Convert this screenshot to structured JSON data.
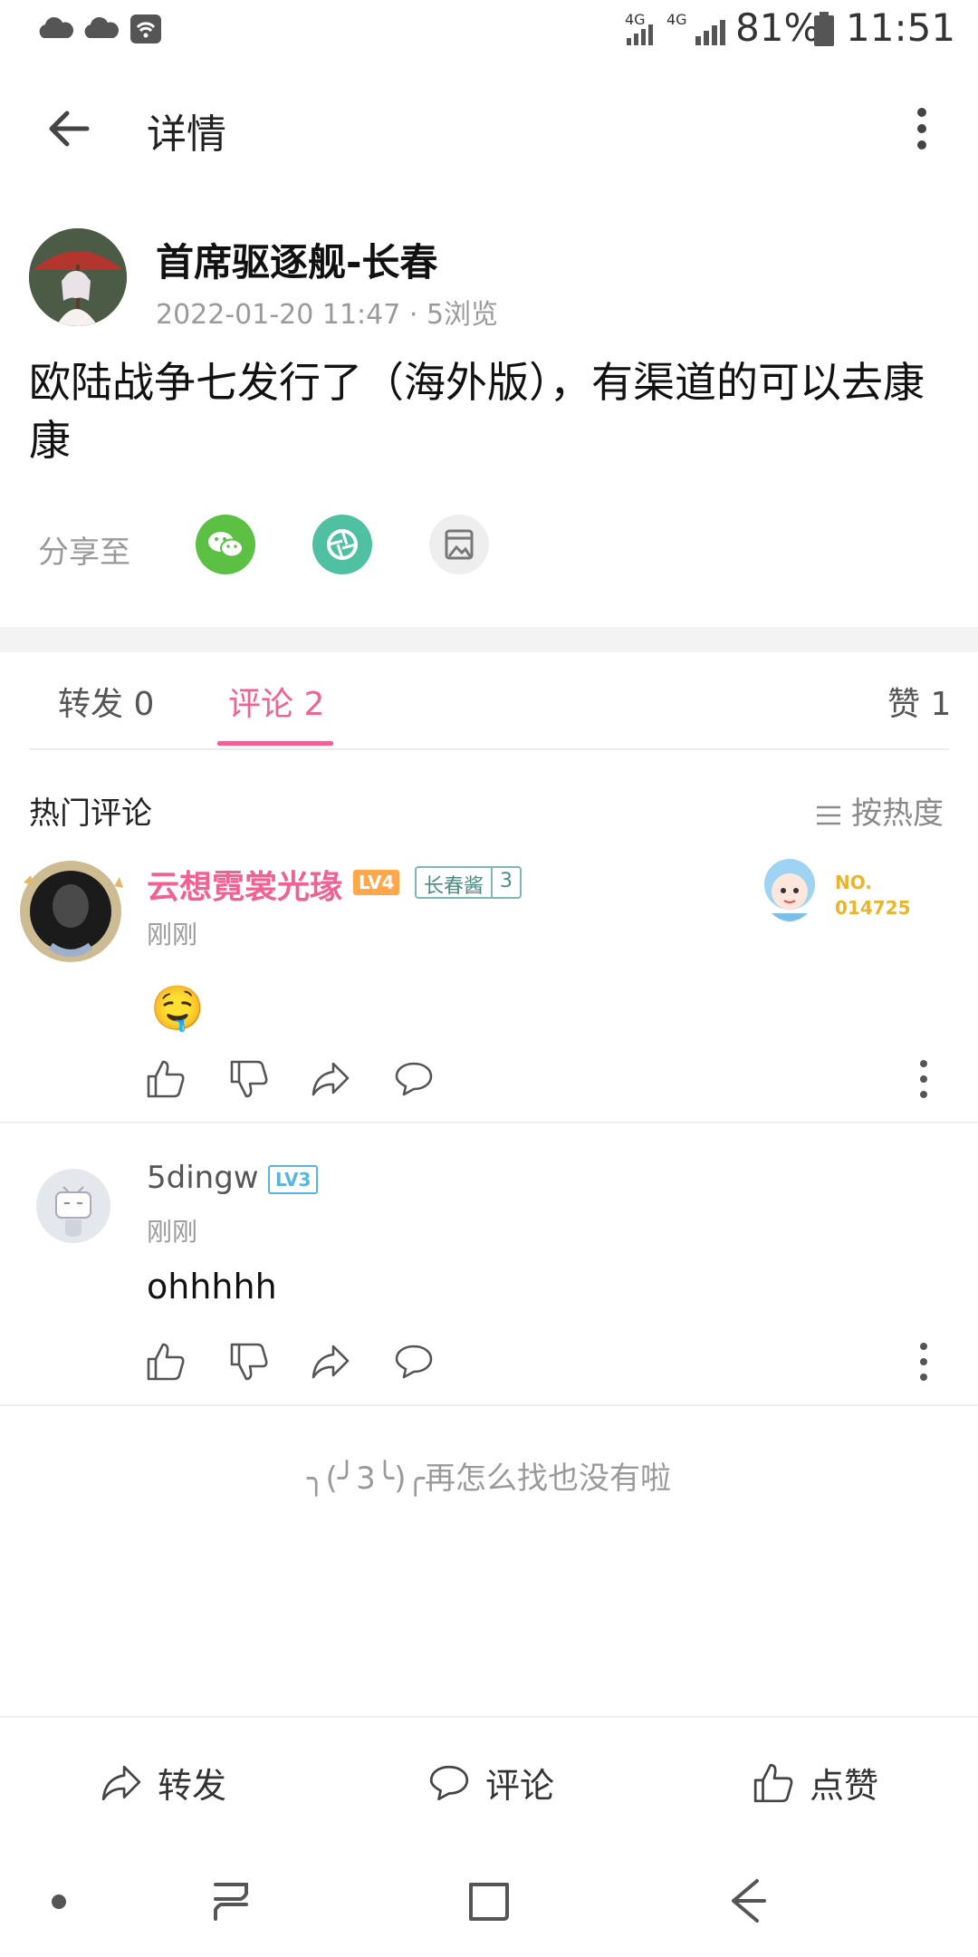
{
  "status_bar": {
    "net1": "4G",
    "net2": "4G",
    "battery": "81%",
    "time": "11:51"
  },
  "header": {
    "title": "详情"
  },
  "post": {
    "author": "首席驱逐舰-长春",
    "meta": "2022-01-20 11:47 · 5浏览",
    "content": "欧陆战争七发行了（海外版），有渠道的可以去康康",
    "share_label": "分享至"
  },
  "tabs": {
    "repost": "转发 0",
    "comments": "评论 2",
    "likes": "赞 1"
  },
  "hot": {
    "label": "热门评论",
    "sort": "按热度"
  },
  "comments": [
    {
      "name": "云想霓裳光瑑",
      "level": "LV4",
      "fan_badge_name": "长春酱",
      "fan_badge_level": "3",
      "time": "刚刚",
      "content_emoji": "🤤",
      "medal_no": "NO.",
      "medal_num": "014725",
      "name_color": "#f06292"
    },
    {
      "name": "5dingw",
      "level": "LV3",
      "time": "刚刚",
      "content": "ohhhhh",
      "name_color": "#555555"
    }
  ],
  "no_more": "╮(╯3╰)╭再怎么找也没有啦",
  "bottom_bar": {
    "repost": "转发",
    "comment": "评论",
    "like": "点赞"
  },
  "colors": {
    "accent": "#f06292",
    "wechat": "#5bc044",
    "moments": "#4fc1a2"
  }
}
